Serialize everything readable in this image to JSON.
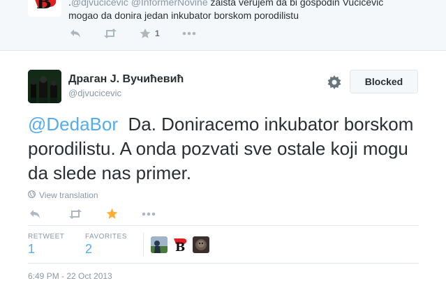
{
  "top_tweet": {
    "mentions_line_start": ".",
    "mention1": "@djvucicevic",
    "mention2": "@InformerNovine",
    "line1_rest": " zaista verujem da bi gospodin Vucicevic",
    "line2": "mogao da donira jedan inkubator borskom porodilistu",
    "favorite_count": "1"
  },
  "tweet": {
    "fullname": "Драган Ј. Вучићевић",
    "username": "@djvucicevic",
    "blocked_label": "Blocked",
    "mention": "@DedaBor",
    "text": "  Da. Doniracemo inkubator borskom porodilistu. A onda pozvati sve ostale koji mogu da slede nas primer.",
    "view_translation": "View translation",
    "stats": {
      "retweets_label": "RETWEET",
      "retweets": "1",
      "favorites_label": "FAVORITES",
      "favorites": "2"
    },
    "timestamp": "6:49 PM - 22 Oct 2013"
  },
  "colors": {
    "link": "#55acee",
    "favorite_star": "#ffac33",
    "muted": "#8899a6"
  },
  "icons": [
    "reply-icon",
    "retweet-icon",
    "favorite-icon",
    "more-icon",
    "gear-icon",
    "globe-icon"
  ]
}
